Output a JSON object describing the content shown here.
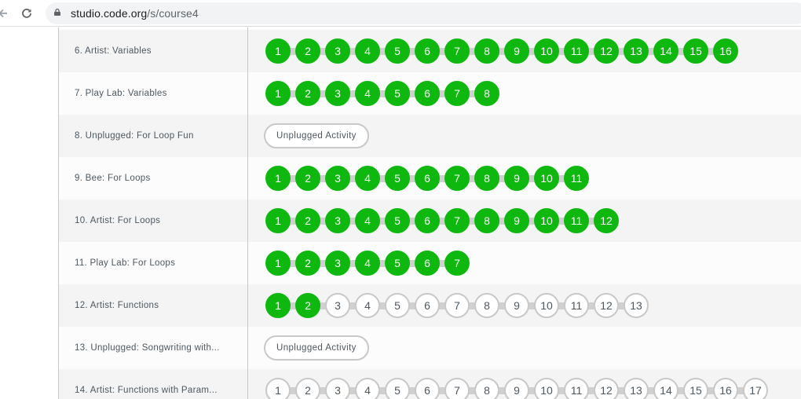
{
  "browser": {
    "url_domain": "studio.code.org",
    "url_path": "/s/course4"
  },
  "rows": [
    {
      "name": "6. Artist: Variables",
      "levels": [
        "1",
        "2",
        "3",
        "4",
        "5",
        "6",
        "7",
        "8",
        "9",
        "10",
        "11",
        "12",
        "13",
        "14",
        "15",
        "16"
      ],
      "completed": 16
    },
    {
      "name": "7. Play Lab: Variables",
      "levels": [
        "1",
        "2",
        "3",
        "4",
        "5",
        "6",
        "7",
        "8"
      ],
      "completed": 8
    },
    {
      "name": "8. Unplugged: For Loop Fun",
      "unplugged": "Unplugged Activity"
    },
    {
      "name": "9. Bee: For Loops",
      "levels": [
        "1",
        "2",
        "3",
        "4",
        "5",
        "6",
        "7",
        "8",
        "9",
        "10",
        "11"
      ],
      "completed": 11
    },
    {
      "name": "10. Artist: For Loops",
      "levels": [
        "1",
        "2",
        "3",
        "4",
        "5",
        "6",
        "7",
        "8",
        "9",
        "10",
        "11",
        "12"
      ],
      "completed": 12
    },
    {
      "name": "11. Play Lab: For Loops",
      "levels": [
        "1",
        "2",
        "3",
        "4",
        "5",
        "6",
        "7"
      ],
      "completed": 7
    },
    {
      "name": "12. Artist: Functions",
      "levels": [
        "1",
        "2",
        "3",
        "4",
        "5",
        "6",
        "7",
        "8",
        "9",
        "10",
        "11",
        "12",
        "13"
      ],
      "completed": 2
    },
    {
      "name": "13. Unplugged: Songwriting with...",
      "unplugged": "Unplugged Activity"
    },
    {
      "name": "14. Artist: Functions with Param...",
      "levels": [
        "1",
        "2",
        "3",
        "4",
        "5",
        "6",
        "7",
        "8",
        "9",
        "10",
        "11",
        "12",
        "13",
        "14",
        "15",
        "16",
        "17"
      ],
      "completed": 0
    }
  ],
  "colors": {
    "completed": "#0eb80e",
    "not_started_border": "#c8c8c8",
    "text": "#4d575f"
  },
  "icons": {
    "back": "arrow-left-icon",
    "reload": "reload-icon",
    "lock": "lock-icon"
  }
}
